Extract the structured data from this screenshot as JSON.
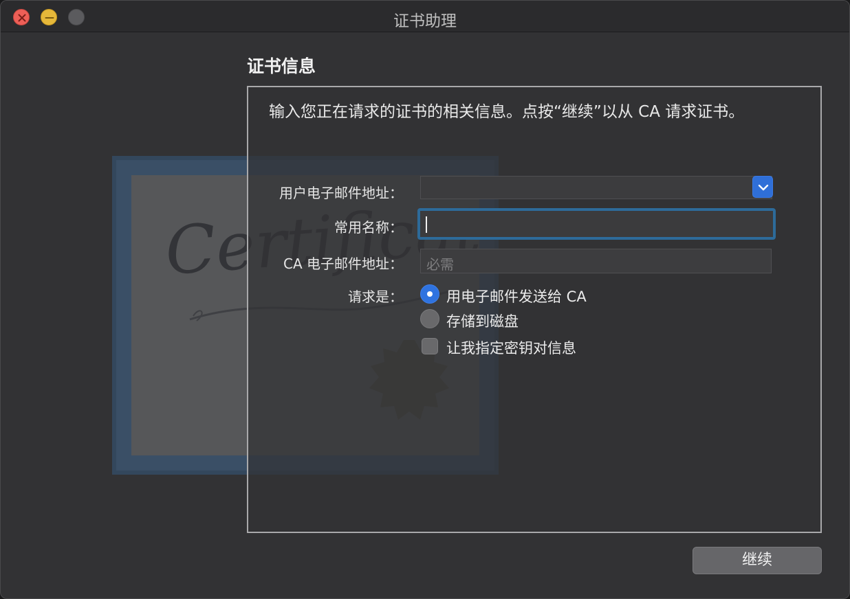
{
  "window": {
    "title": "证书助理"
  },
  "section": {
    "title": "证书信息"
  },
  "intro": {
    "text": "输入您正在请求的证书的相关信息。点按“继续”以从 CA 请求证书。"
  },
  "form": {
    "email_label": "用户电子邮件地址：",
    "email_value": "",
    "common_name_label": "常用名称：",
    "common_name_value": "",
    "ca_email_label": "CA 电子邮件地址：",
    "ca_email_placeholder": "必需",
    "request_label": "请求是：",
    "options": {
      "email_to_ca": "用电子邮件发送给 CA",
      "save_to_disk": "存储到磁盘",
      "specify_key_pair": "让我指定密钥对信息"
    },
    "selected_option": "email_to_ca",
    "specify_key_pair_checked": false
  },
  "buttons": {
    "continue": "继续"
  },
  "illustration": {
    "script_text": "Certificate"
  },
  "colors": {
    "accent": "#2f73e0",
    "focus_ring": "#2d6b9a",
    "close": "#ed5f57",
    "minimize": "#e6b83a"
  }
}
